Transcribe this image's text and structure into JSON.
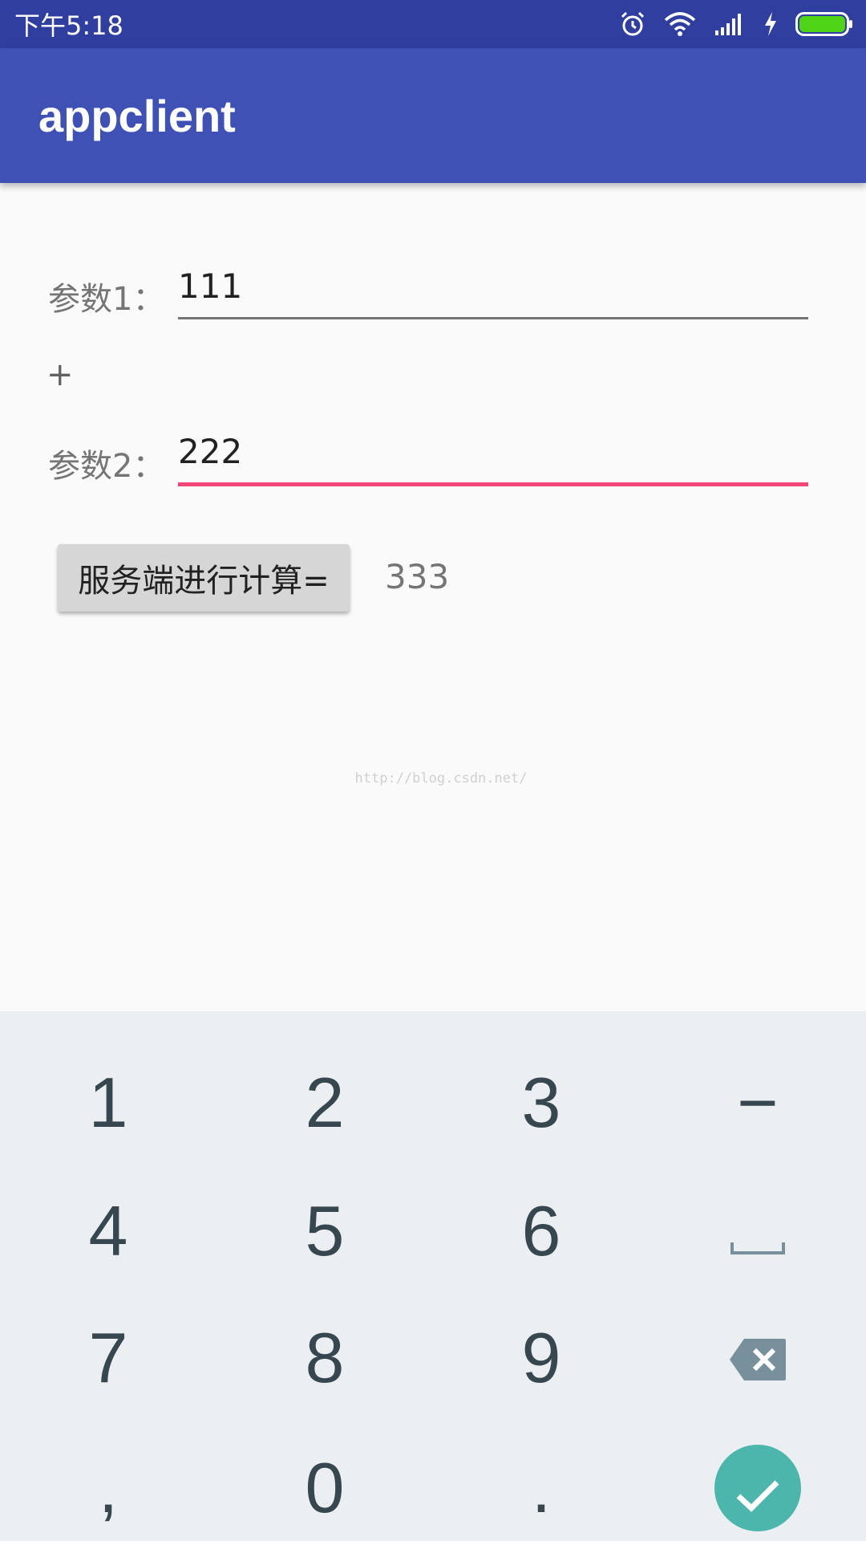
{
  "status_bar": {
    "time": "下午5:18"
  },
  "app_bar": {
    "title": "appclient"
  },
  "form": {
    "param1_label": "参数1：",
    "param1_value": "111",
    "operator": "+",
    "param2_label": "参数2：",
    "param2_value": "222",
    "calc_button": "服务端进行计算=",
    "result": "333"
  },
  "watermark": "http://blog.csdn.net/",
  "keyboard": {
    "rows": [
      [
        "1",
        "2",
        "3",
        "−"
      ],
      [
        "4",
        "5",
        "6",
        "space-icon"
      ],
      [
        "7",
        "8",
        "9",
        "backspace-icon"
      ],
      [
        ",",
        "0",
        ".",
        "done-icon"
      ]
    ],
    "k1": "1",
    "k2": "2",
    "k3": "3",
    "minus": "−",
    "k4": "4",
    "k5": "5",
    "k6": "6",
    "k7": "7",
    "k8": "8",
    "k9": "9",
    "comma": ",",
    "k0": "0",
    "dot": "."
  },
  "colors": {
    "status_bar": "#303f9f",
    "app_bar": "#3f51b5",
    "accent": "#f0467a",
    "keyboard_bg": "#eceff1",
    "done_button": "#4db6ac"
  }
}
